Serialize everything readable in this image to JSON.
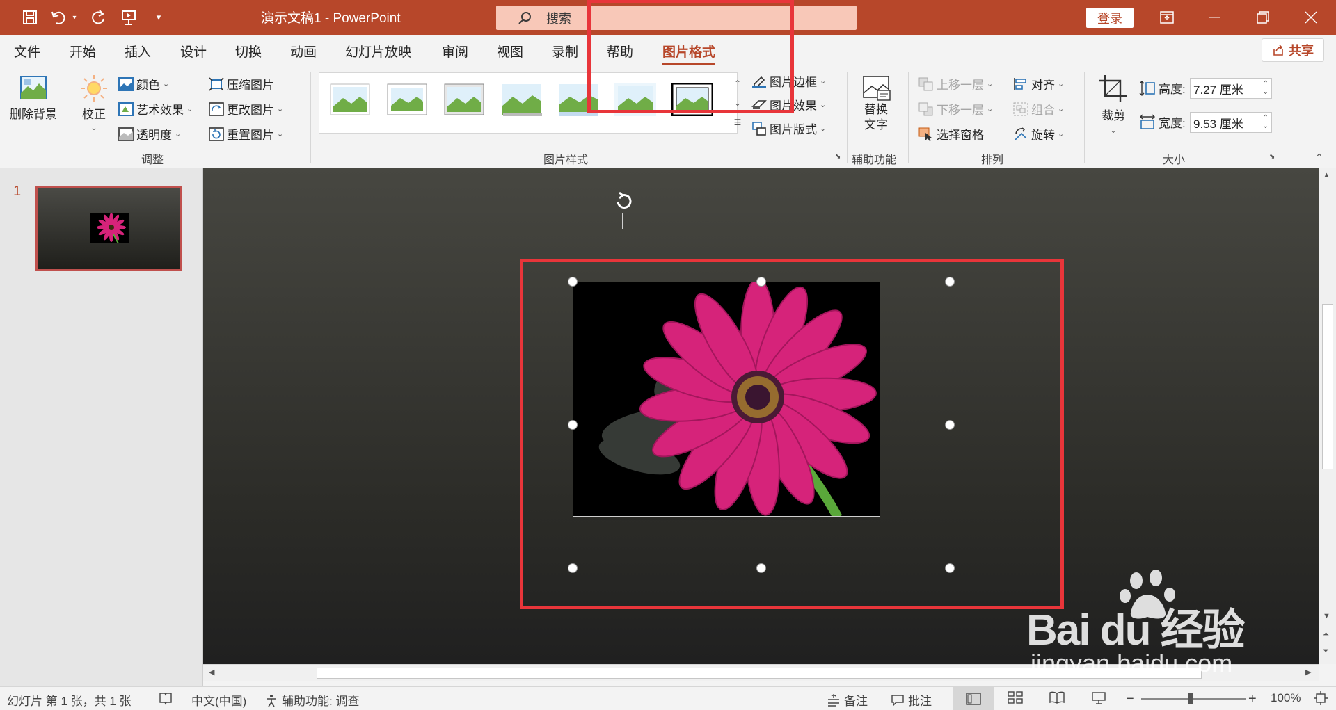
{
  "app": {
    "title": "演示文稿1  -  PowerPoint",
    "search_label": "搜索",
    "login": "登录",
    "share": "共享"
  },
  "tabs": [
    "文件",
    "开始",
    "插入",
    "设计",
    "切换",
    "动画",
    "幻灯片放映",
    "审阅",
    "视图",
    "录制",
    "帮助",
    "图片格式"
  ],
  "active_tab": "图片格式",
  "ribbon": {
    "remove_bg": "删除背景",
    "corrections": "校正",
    "color": "颜色",
    "artistic": "艺术效果",
    "transparency": "透明度",
    "compress": "压缩图片",
    "change": "更改图片",
    "reset": "重置图片",
    "group_adjust": "调整",
    "border": "图片边框",
    "effects": "图片效果",
    "layout": "图片版式",
    "group_styles": "图片样式",
    "alt_text_1": "替换",
    "alt_text_2": "文字",
    "group_access": "辅助功能",
    "bring_forward": "上移一层",
    "send_backward": "下移一层",
    "selection_pane": "选择窗格",
    "align": "对齐",
    "group": "组合",
    "rotate": "旋转",
    "group_arrange": "排列",
    "crop": "裁剪",
    "height_label": "高度:",
    "height_value": "7.27 厘米",
    "width_label": "宽度:",
    "width_value": "9.53 厘米",
    "group_size": "大小"
  },
  "slides": {
    "current_number": "1"
  },
  "statusbar": {
    "slide_info": "幻灯片 第 1 张，共 1 张",
    "language": "中文(中国)",
    "accessibility": "辅助功能: 调查",
    "notes": "备注",
    "comments": "批注",
    "zoom": "100%"
  },
  "watermark": {
    "brand": "Bai du 经验",
    "url": "jingyan.baidu.com"
  },
  "colors": {
    "accent": "#b7472a",
    "highlight": "#e8353a",
    "flower": "#d6237a"
  }
}
